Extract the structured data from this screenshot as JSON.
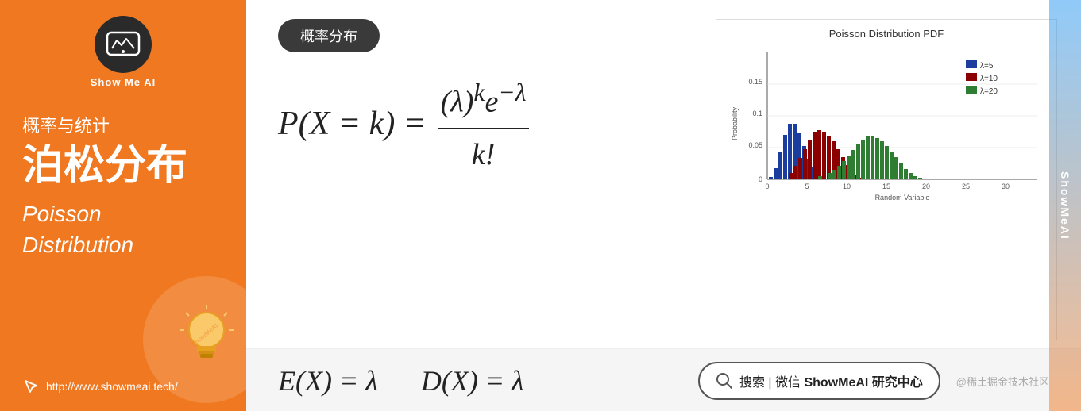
{
  "sidebar": {
    "logo_alt": "ShowMeAI logo",
    "brand_name": "Show Me AI",
    "subtitle": "概率与统计",
    "main_title": "泊松分布",
    "italic_line1": "Poisson",
    "italic_line2": "Distribution",
    "url": "http://www.showmeai.tech/"
  },
  "main": {
    "badge_label": "概率分布",
    "formula_main": "P(X = k) = (λ)ᵏe⁻λ / k!",
    "formula_secondary": "E(X) = λ    D(X) = λ",
    "chart": {
      "title": "Poisson Distribution PDF",
      "x_label": "Random Variable",
      "y_label": "Probability",
      "legend": [
        {
          "label": "λ=5",
          "color": "#1a3d9e"
        },
        {
          "label": "λ=10",
          "color": "#8B0000"
        },
        {
          "label": "λ=20",
          "color": "#2e7d32"
        }
      ]
    },
    "search_label": "搜索 | 微信",
    "search_brand": "ShowMeAI 研究中心",
    "community_label": "@稀土掘金技术社区"
  }
}
